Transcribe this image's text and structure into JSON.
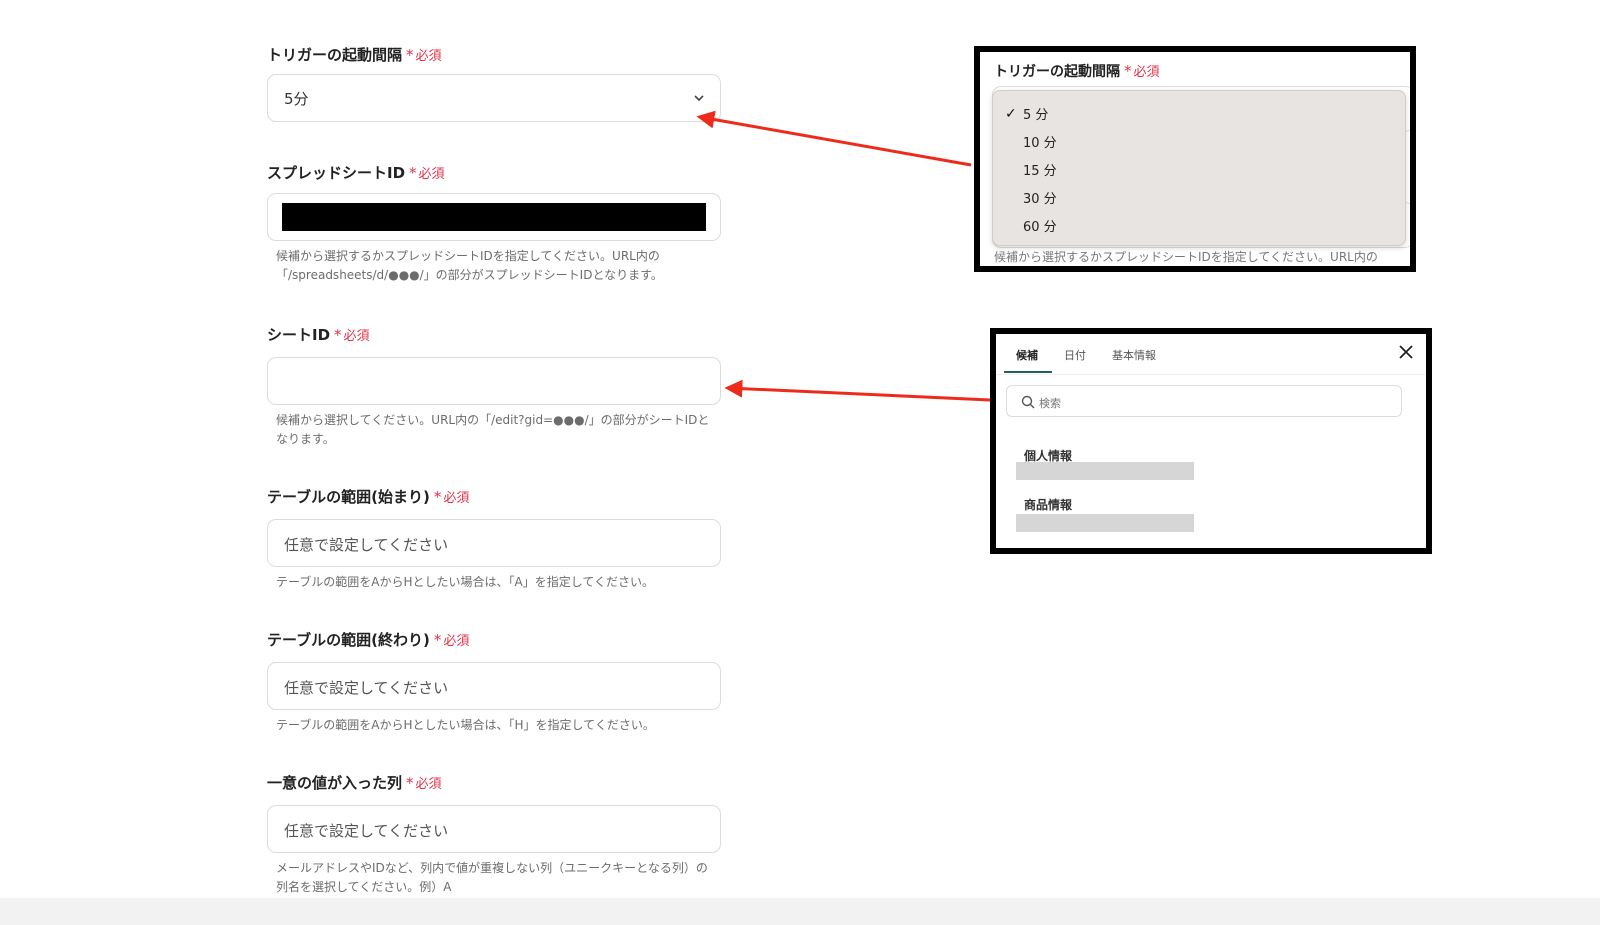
{
  "required_label": "必須",
  "fields": [
    {
      "label": "トリガーの起動間隔",
      "value": "5分"
    },
    {
      "label": "スプレッドシートID",
      "help_line1": "候補から選択するかスプレッドシートIDを指定してください。URL内の",
      "help_line2": "「/spreadsheets/d/●●●/」の部分がスプレッドシートIDとなります。"
    },
    {
      "label": "シートID",
      "help_line1": "候補から選択してください。URL内の「/edit?gid=●●●/」の部分がシートIDと",
      "help_line2": "なります。"
    },
    {
      "label": "テーブルの範囲(始まり)",
      "placeholder": "任意で設定してください",
      "help_line1": "テーブルの範囲をAからHとしたい場合は、「A」を指定してください。"
    },
    {
      "label": "テーブルの範囲(終わり)",
      "placeholder": "任意で設定してください",
      "help_line1": "テーブルの範囲をAからHとしたい場合は、「H」を指定してください。"
    },
    {
      "label": "一意の値が入った列",
      "placeholder": "任意で設定してください",
      "help_line1": "メールアドレスやIDなど、列内で値が重複しない列（ユニークキーとなる列）の",
      "help_line2": "列名を選択してください。例）A"
    }
  ],
  "interval_popup": {
    "label": "トリガーの起動間隔",
    "options": [
      "5 分",
      "10 分",
      "15 分",
      "30 分",
      "60 分"
    ],
    "selected_index": 0,
    "help_partial": "候補から選択するかスプレッドシートIDを指定してください。URL内の"
  },
  "sheet_popup": {
    "tabs": [
      "候補",
      "日付",
      "基本情報"
    ],
    "active_tab_index": 0,
    "search_placeholder": "検索",
    "items": [
      "個人情報",
      "商品情報"
    ]
  },
  "colors": {
    "required": "#e0334a",
    "arrow": "#ee2a1b",
    "dropdown_bg": "#e7e4e2"
  },
  "icons": {
    "dropdown": "chevron-down-icon",
    "selected": "checkmark-icon",
    "close": "close-icon",
    "search": "search-icon"
  }
}
